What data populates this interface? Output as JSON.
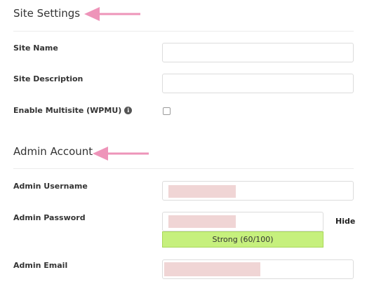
{
  "site_settings": {
    "title": "Site Settings",
    "fields": {
      "site_name_label": "Site Name",
      "site_description_label": "Site Description",
      "multisite_label": "Enable Multisite (WPMU)",
      "multisite_info_glyph": "i",
      "multisite_checked": false,
      "site_name_value": "",
      "site_description_value": ""
    }
  },
  "admin_account": {
    "title": "Admin Account",
    "fields": {
      "username_label": "Admin Username",
      "password_label": "Admin Password",
      "email_label": "Admin Email",
      "hide_label": "Hide",
      "strength_text": "Strong (60/100)"
    }
  },
  "colors": {
    "arrow": "#ee94b9",
    "strength_bar": "#c6f07d",
    "redaction": "#f0d5d5"
  }
}
